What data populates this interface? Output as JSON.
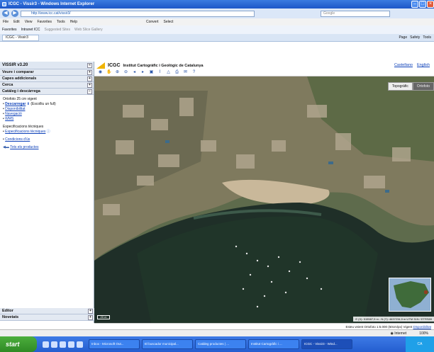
{
  "window": {
    "title": "ICGC - Vissir3 - Windows Internet Explorer"
  },
  "address": {
    "url": "http://www.icc.cat/vissir3/",
    "search_placeholder": "Google"
  },
  "menu": [
    "File",
    "Edit",
    "View",
    "Favorites",
    "Tools",
    "Help"
  ],
  "convert": {
    "convert_label": "Convert",
    "select_label": "Select"
  },
  "favorites": {
    "label": "Favorites",
    "intranet": "Intranet ICC",
    "suggested": "Suggested Sites",
    "gallery": "Web Slice Gallery"
  },
  "tab": {
    "label": "ICGC - Vissir3"
  },
  "commands": [
    "Page",
    "Safety",
    "Tools"
  ],
  "sidebar": {
    "title": "VISSIR v3.20",
    "sections": [
      "Veure i comparar",
      "Capes addicionals",
      "Cerca",
      "Catàleg i descàrrega"
    ],
    "ortho": "Ortofoto 25 cm vigent",
    "download": "Descarregar",
    "download_note": "(Escolliu un full)",
    "links": [
      "Disponibilitat",
      "Navegació",
      "WMS"
    ],
    "specs_title": "Especificacions tècniques",
    "specs_link": "Especificacions tècniques",
    "conditions": "Condicions d'ús",
    "all_products": "Tots els productes",
    "bottom_sections": [
      "Editor",
      "Novetats"
    ]
  },
  "header": {
    "logo": "ICGC",
    "institution": "Institut Cartogràfic i Geològic de Catalunya",
    "lang": [
      "Castellano",
      "English"
    ]
  },
  "map": {
    "layer_tabs": [
      "Topogràfic",
      "Ortofoto"
    ],
    "scale": "20 m",
    "coords": "E (X): 515587,9 m - N (Y): 4637234,9 m UTM 31N / ETRS89"
  },
  "infobar": {
    "text": "Esteu veient Ortofoto 1:5.000 (50cm/px) Vigent",
    "link": "Disponibilitat"
  },
  "status": {
    "zone": "Internet",
    "zoom": "100%"
  },
  "taskbar": {
    "start": "start",
    "buttons": [
      "Inbox - Microsoft Out...",
      "El buscador municipal...",
      "Catàleg productes | ...",
      "Institut Cartogràfic i ...",
      "ICGC - Vissir3 - Wind..."
    ],
    "tray": "CA"
  },
  "colors": {
    "accent": "#0b3fb8",
    "logo": "#f0b400",
    "taskbar": "#245ed0",
    "start": "#2f8a25"
  }
}
